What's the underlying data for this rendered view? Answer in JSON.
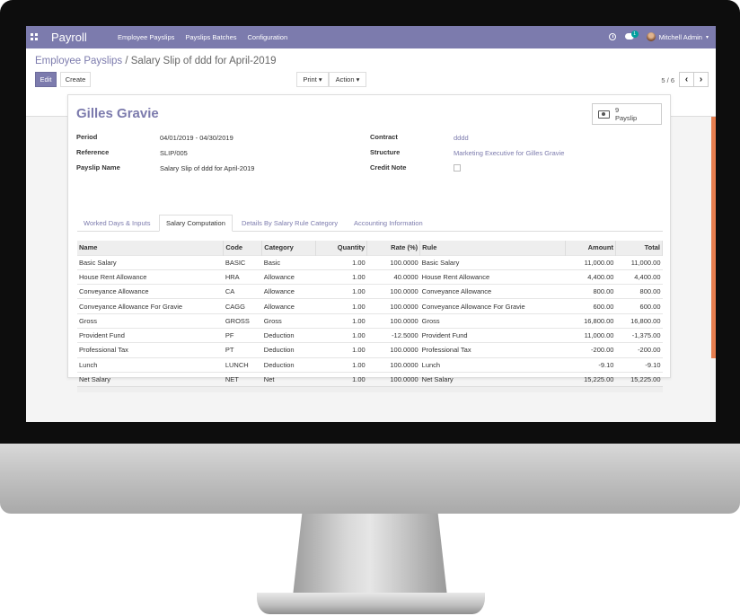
{
  "navbar": {
    "app_name": "Payroll",
    "menu": [
      "Employee Payslips",
      "Payslips Batches",
      "Configuration"
    ],
    "chat_badge": "1",
    "user_name": "Mitchell Admin",
    "caret": "▾",
    "accent_color": "#7c7bad"
  },
  "breadcrumb": {
    "parent": "Employee Payslips",
    "separator": "/",
    "current": "Salary Slip of ddd for April-2019"
  },
  "buttons": {
    "edit": "Edit",
    "create": "Create",
    "print": "Print ▾",
    "action": "Action ▾"
  },
  "pager": {
    "value": "5 / 6",
    "prev": "‹",
    "next": "›"
  },
  "form": {
    "employee_name": "Gilles Gravie",
    "smart_button": {
      "count": "9",
      "label": "Payslip",
      "icon": "money-icon"
    },
    "left_fields": [
      {
        "label": "Period",
        "value": "04/01/2019 - 04/30/2019"
      },
      {
        "label": "Reference",
        "value": "SLIP/005"
      },
      {
        "label": "Payslip Name",
        "value": "Salary Slip of ddd for April-2019"
      }
    ],
    "right_fields": [
      {
        "label": "Contract",
        "value": "dddd"
      },
      {
        "label": "Structure",
        "value": "Marketing Executive for Gilles Gravie"
      },
      {
        "label": "Credit Note",
        "value": ""
      }
    ],
    "tabs": [
      "Worked Days & Inputs",
      "Salary Computation",
      "Details By Salary Rule Category",
      "Accounting Information"
    ],
    "active_tab": 1
  },
  "table": {
    "columns": [
      "Name",
      "Code",
      "Category",
      "Quantity",
      "Rate (%)",
      "Rule",
      "Amount",
      "Total"
    ],
    "rows": [
      [
        "Basic Salary",
        "BASIC",
        "Basic",
        "1.00",
        "100.0000",
        "Basic Salary",
        "11,000.00",
        "11,000.00"
      ],
      [
        "House Rent Allowance",
        "HRA",
        "Allowance",
        "1.00",
        "40.0000",
        "House Rent Allowance",
        "4,400.00",
        "4,400.00"
      ],
      [
        "Conveyance Allowance",
        "CA",
        "Allowance",
        "1.00",
        "100.0000",
        "Conveyance Allowance",
        "800.00",
        "800.00"
      ],
      [
        "Conveyance Allowance For Gravie",
        "CAGG",
        "Allowance",
        "1.00",
        "100.0000",
        "Conveyance Allowance For Gravie",
        "600.00",
        "600.00"
      ],
      [
        "Gross",
        "GROSS",
        "Gross",
        "1.00",
        "100.0000",
        "Gross",
        "16,800.00",
        "16,800.00"
      ],
      [
        "Provident Fund",
        "PF",
        "Deduction",
        "1.00",
        "-12.5000",
        "Provident Fund",
        "11,000.00",
        "-1,375.00"
      ],
      [
        "Professional Tax",
        "PT",
        "Deduction",
        "1.00",
        "100.0000",
        "Professional Tax",
        "-200.00",
        "-200.00"
      ],
      [
        "Lunch",
        "LUNCH",
        "Deduction",
        "1.00",
        "100.0000",
        "Lunch",
        "-9.10",
        "-9.10"
      ],
      [
        "Net Salary",
        "NET",
        "Net",
        "1.00",
        "100.0000",
        "Net Salary",
        "15,225.00",
        "15,225.00"
      ]
    ]
  }
}
